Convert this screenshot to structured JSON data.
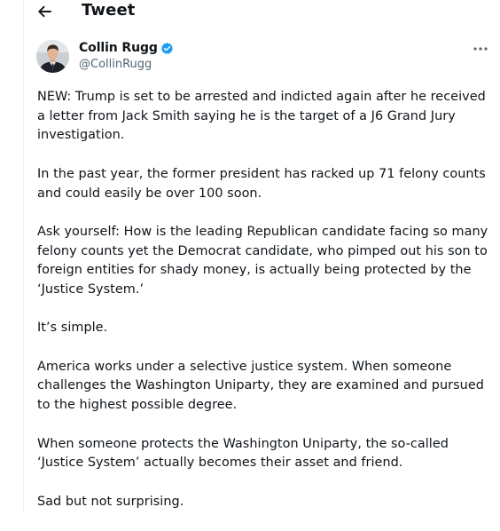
{
  "header": {
    "title": "Tweet"
  },
  "tweet": {
    "author": {
      "name": "Collin Rugg",
      "handle": "@CollinRugg",
      "verified": true
    },
    "paragraphs": [
      "NEW: Trump is set to be arrested and indicted again after he received a letter from Jack Smith saying he is the target of a J6 Grand Jury investigation.",
      "In the past year, the former president has racked up 71 felony counts and could easily be over 100 soon.",
      "Ask yourself: How is the leading Republican candidate facing so many felony counts yet the Democrat candidate, who pimped out his son to foreign entities for shady money, is actually being protected by the ‘Justice System.’",
      "It’s simple.",
      "America works under a selective justice system. When someone challenges the Washington Uniparty, they are examined  and pursued to the highest possible degree.",
      "When someone protects the Washington Uniparty, the so-called ‘Justice System’ actually becomes their asset and friend.",
      "Sad but not surprising."
    ]
  },
  "icons": {
    "back": "arrow-left-icon",
    "verified": "verified-badge-icon",
    "more": "more-horizontal-icon"
  },
  "colors": {
    "text_primary": "#0f1419",
    "text_secondary": "#536471",
    "verified_blue": "#1d9bf0",
    "divider": "#eff3f4"
  }
}
